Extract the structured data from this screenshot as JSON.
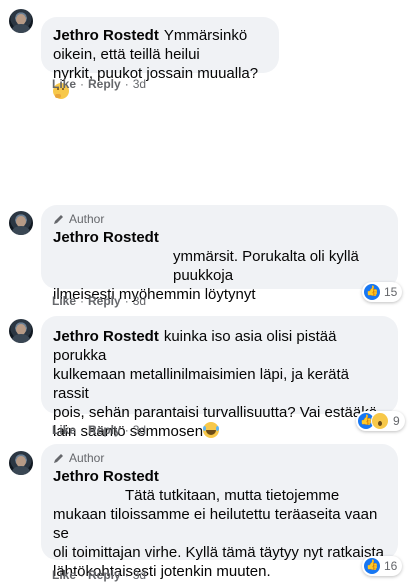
{
  "comments": [
    {
      "author": "Jethro Rostedt",
      "author_badge": "",
      "text_line1": "Ymmärsinkö oikein, että teillä heilui",
      "text_line2": "nyrkit, puukot jossain muualla?",
      "emoji": "thinking-face",
      "like": "Like",
      "reply": "Reply",
      "time": "3d",
      "reaction_count": ""
    },
    {
      "author": "Jethro Rostedt",
      "author_badge": "Author",
      "text_line1": "ymmärsit. Porukalta oli kyllä puukkoja",
      "text_line2": "ilmeisesti myöhemmin löytynyt",
      "like": "Like",
      "reply": "Reply",
      "time": "3d",
      "reaction_count": "15",
      "reaction_types": [
        "like"
      ]
    },
    {
      "author": "Jethro Rostedt",
      "author_badge": "",
      "text_line1": "kuinka iso asia olisi pistää porukka",
      "text_line2": "kulkemaan metallinilmaisimien läpi, ja kerätä rassit",
      "text_line3": "pois, sehän parantaisi turvallisuutta? Vai estääkö",
      "text_line4": "lain sääntö semmosen",
      "emoji": "laughing-face",
      "like": "Like",
      "reply": "Reply",
      "time": "3d",
      "reaction_count": "9",
      "reaction_types": [
        "like",
        "wow"
      ]
    },
    {
      "author": "Jethro Rostedt",
      "author_badge": "Author",
      "text_line1": "Tätä tutkitaan, mutta tietojemme",
      "text_line2": "mukaan tiloissamme ei heilutettu teräaseita vaan se",
      "text_line3": "oli toimittajan virhe. Kyllä tämä täytyy nyt ratkaista",
      "text_line4": "lähtökohtaisesti jotenkin muuten.",
      "like": "Like",
      "reply": "Reply",
      "time": "3d",
      "reaction_count": "16",
      "reaction_types": [
        "like"
      ]
    }
  ],
  "colors": {
    "bubble_bg": "#f0f2f5",
    "meta_text": "#65676b",
    "like_blue": "#1877f2"
  }
}
